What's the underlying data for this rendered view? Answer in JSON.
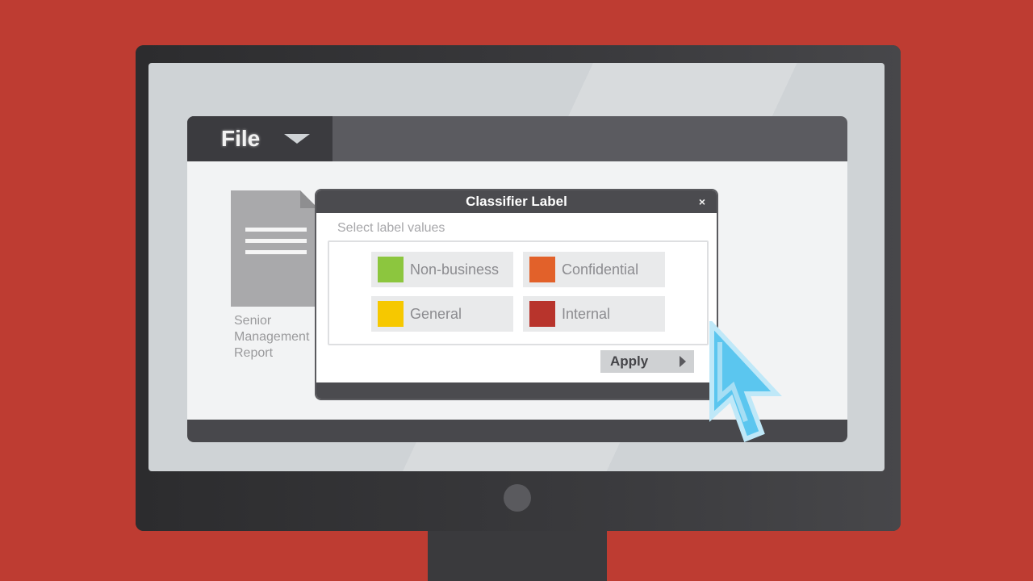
{
  "app": {
    "file_menu_label": "File"
  },
  "document": {
    "caption": "Senior Management Report"
  },
  "dialog": {
    "title": "Classifier Label",
    "close_glyph": "×",
    "prompt": "Select label values",
    "options": [
      {
        "label": "Non-business",
        "color": "#8cc63e"
      },
      {
        "label": "Confidential",
        "color": "#e2612a"
      },
      {
        "label": "General",
        "color": "#f6c800"
      },
      {
        "label": "Internal",
        "color": "#b8342c"
      }
    ],
    "apply_label": "Apply"
  },
  "icons": {
    "cursor": "pointer-cursor-icon",
    "file_menu": "chevron-down-icon",
    "close": "close-icon",
    "apply": "play-icon",
    "document": "document-icon"
  },
  "colors": {
    "background": "#be3c32",
    "cursor": "#5bc6ef"
  }
}
